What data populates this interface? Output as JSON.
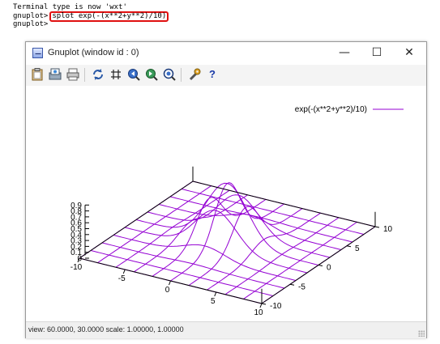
{
  "terminal": {
    "line1": "Terminal type is now 'wxt'",
    "prompt": "gnuplot>",
    "command": "splot exp(-(x**2+y**2)/10)",
    "line3": "gnuplot>"
  },
  "window": {
    "title": "Gnuplot (window id : 0)",
    "minimize_glyph": "—",
    "maximize_glyph": "☐",
    "close_glyph": "✕"
  },
  "toolbar": {
    "icons": [
      "clipboard-icon",
      "export-icon",
      "print-icon",
      "replot-icon",
      "grid-icon",
      "zoom-prev-icon",
      "zoom-next-icon",
      "autoscale-icon",
      "config-icon",
      "help-icon"
    ],
    "help_label": "?"
  },
  "status": {
    "text": "view: 60.0000, 30.0000  scale: 1.00000, 1.00000"
  },
  "chart_data": {
    "type": "surface",
    "title": "",
    "function": "exp(-(x**2+y**2)/10)",
    "legend": "exp(-(x**2+y**2)/10)",
    "legend_placement": "top-right",
    "series_color": "#9400d3",
    "xrange": [
      -10,
      10
    ],
    "yrange": [
      -10,
      10
    ],
    "zrange": [
      0,
      1
    ],
    "x_ticks": [
      "-10",
      "-5",
      "0",
      "5",
      "10"
    ],
    "y_ticks": [
      "-10",
      "-5",
      "0",
      "5",
      "10"
    ],
    "z_ticks": [
      "0",
      "0.1",
      "0.2",
      "0.3",
      "0.4",
      "0.5",
      "0.6",
      "0.7",
      "0.8",
      "0.9"
    ],
    "iso_samples": 10,
    "view": [
      60,
      30
    ]
  }
}
